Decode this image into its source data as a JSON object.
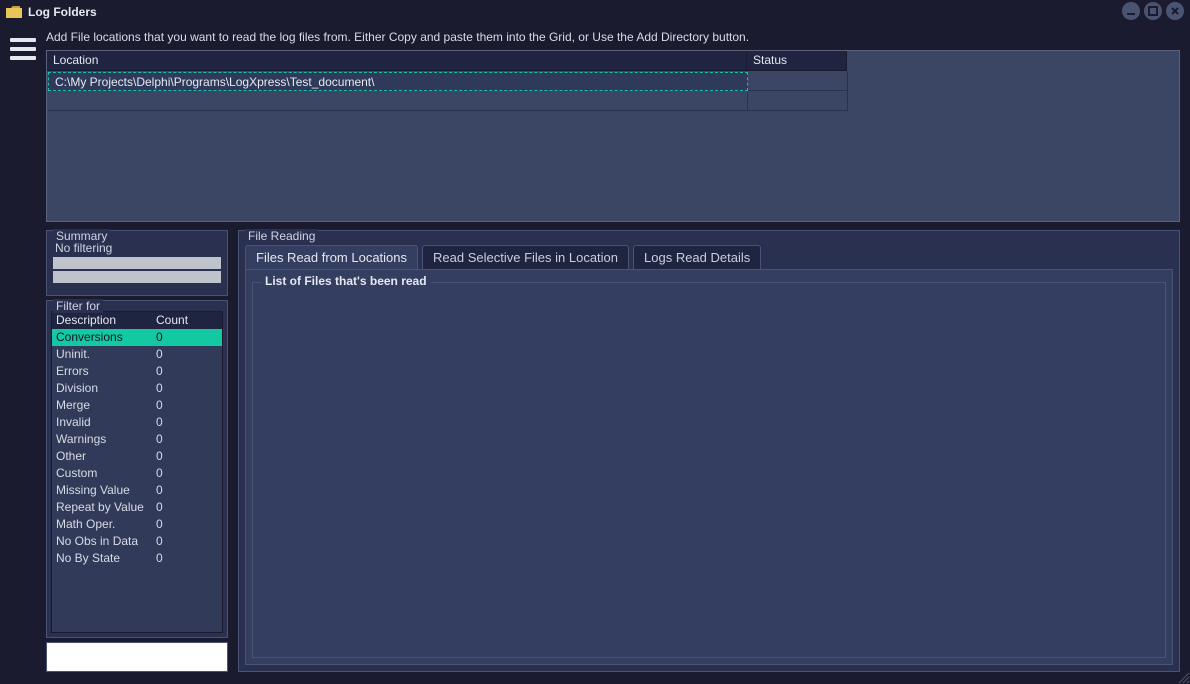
{
  "window": {
    "title": "Log Folders"
  },
  "instruction": "Add File locations that you want to read the log files from. Either Copy and paste them  into the Grid, or Use the Add Directory button.",
  "grid": {
    "col_location": "Location",
    "col_status": "Status",
    "rows": [
      {
        "location": "C:\\My Projects\\Delphi\\Programs\\LogXpress\\Test_document\\",
        "status": ""
      }
    ]
  },
  "summary": {
    "title": "Summary",
    "no_filter": "No filtering",
    "bar1": "",
    "bar2": ""
  },
  "filter": {
    "title": "Filter for",
    "col_desc": "Description",
    "col_count": "Count",
    "rows": [
      {
        "desc": "Conversions",
        "count": "0",
        "selected": true
      },
      {
        "desc": "Uninit.",
        "count": "0"
      },
      {
        "desc": "Errors",
        "count": "0"
      },
      {
        "desc": "Division",
        "count": "0"
      },
      {
        "desc": "Merge",
        "count": "0"
      },
      {
        "desc": "Invalid",
        "count": "0"
      },
      {
        "desc": "Warnings",
        "count": "0"
      },
      {
        "desc": "Other",
        "count": "0"
      },
      {
        "desc": "Custom",
        "count": "0"
      },
      {
        "desc": "Missing Value",
        "count": "0"
      },
      {
        "desc": "Repeat by Value",
        "count": "0"
      },
      {
        "desc": "Math Oper.",
        "count": "0"
      },
      {
        "desc": "No Obs in Data",
        "count": "0"
      },
      {
        "desc": "No By State",
        "count": "0"
      }
    ]
  },
  "file_reading": {
    "title": "File Reading",
    "tabs": {
      "files_read": "Files Read from Locations",
      "selective": "Read Selective Files in Location",
      "details": "Logs Read Details"
    },
    "list_title": "List of Files that's been read"
  }
}
